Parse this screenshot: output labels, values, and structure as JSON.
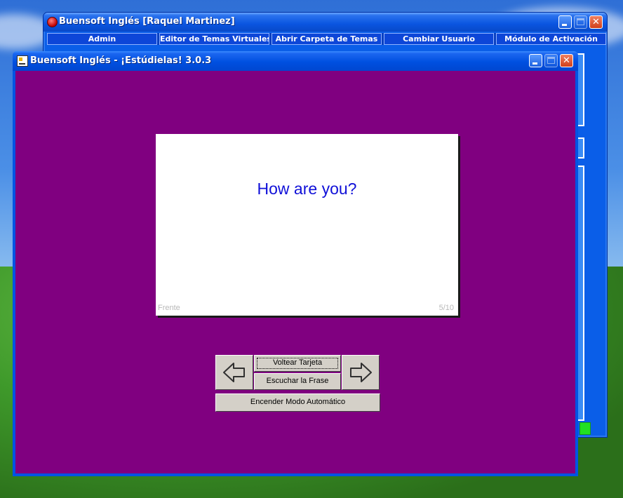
{
  "back_window": {
    "title": "Buensoft Inglés  [Raquel Martinez]",
    "menu": [
      "Admin",
      "Editor de Temas Virtuales",
      "Abrir Carpeta de Temas",
      "Cambiar Usuario",
      "Módulo de Activación"
    ]
  },
  "front_window": {
    "title": "Buensoft Inglés - ¡Estúdielas! 3.0.3"
  },
  "card": {
    "phrase": "How are you?",
    "side": "Frente",
    "counter": "5/10"
  },
  "controls": {
    "flip_label": "Voltear Tarjeta",
    "listen_label": "Escuchar la Frase",
    "auto_label": "Encender Modo Automático"
  },
  "colors": {
    "client_bg": "#800080",
    "phrase_color": "#1010d8",
    "xp_titlebar": "#0054e3"
  },
  "icons": [
    "previous-arrow-icon",
    "next-arrow-icon",
    "minimize-icon",
    "maximize-icon",
    "close-icon"
  ]
}
